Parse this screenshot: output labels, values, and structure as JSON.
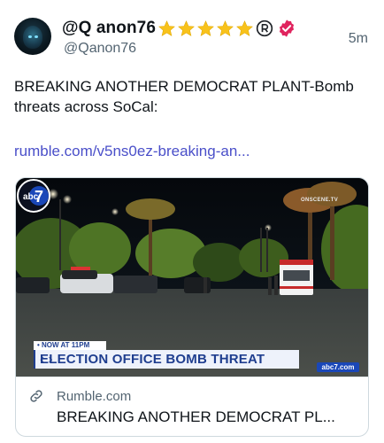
{
  "post": {
    "display_name": "@Q anon76",
    "handle": "@Qanon76",
    "time": "5m",
    "body": "BREAKING ANOTHER DEMOCRAT PLANT-Bomb threats across SoCal:",
    "link": "rumble.com/v5ns0ez-breaking-an..."
  },
  "card": {
    "domain": "Rumble.com",
    "title": "BREAKING ANOTHER DEMOCRAT PL...",
    "thumbnail": {
      "lower_third_top": "• NOW AT 11PM",
      "lower_third_main": "ELECTION OFFICE BOMB THREAT",
      "network_url": "abc7.com",
      "logo_text": "abc",
      "logo_number": "7",
      "watermark": "ONSCENE.TV"
    }
  },
  "colors": {
    "link": "#4a4fc9",
    "star": "#f8c21b",
    "verified": "#e0245e",
    "banner_blue": "#1f3e8f"
  },
  "icons": {
    "stars": [
      "star-icon",
      "star-icon",
      "star-icon",
      "star-icon",
      "star-icon"
    ],
    "registered": "registered-icon",
    "verified": "verified-badge-icon",
    "link": "link-icon"
  }
}
